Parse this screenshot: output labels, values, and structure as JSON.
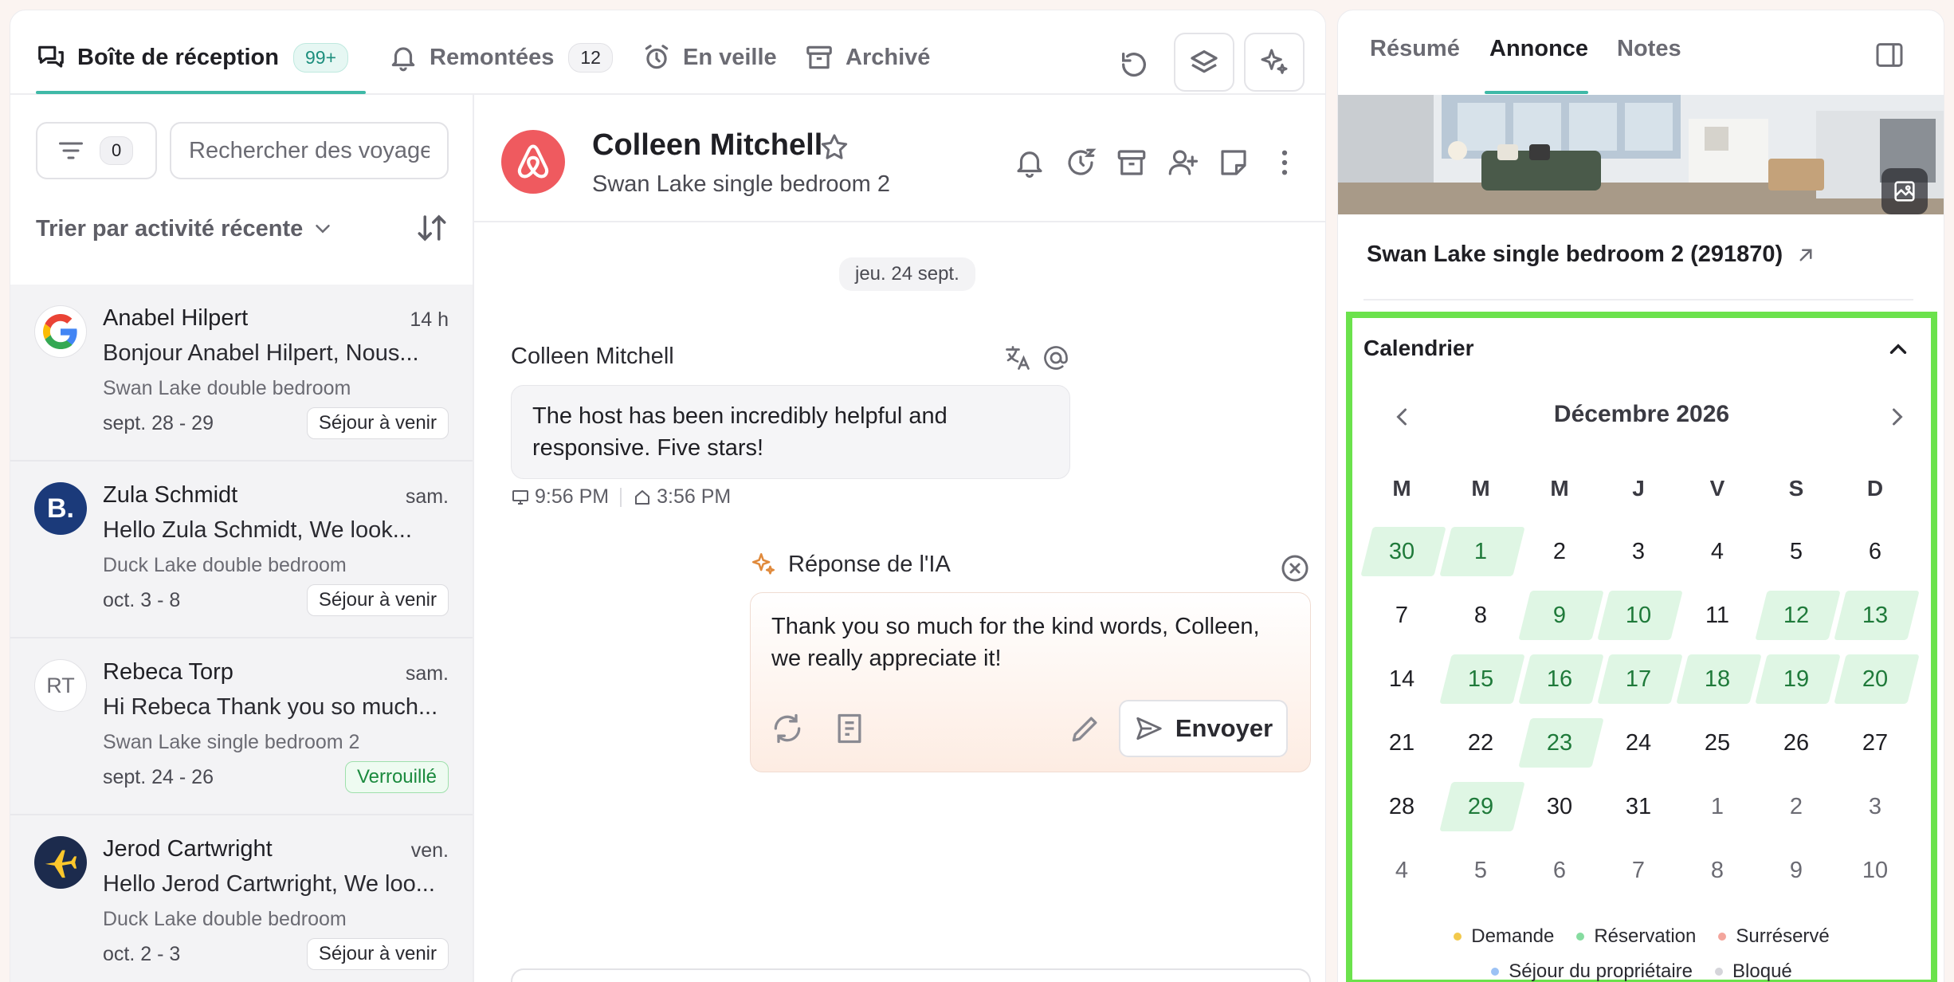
{
  "tabs": {
    "inbox": {
      "label": "Boîte de réception",
      "badge": "99+"
    },
    "escalated": {
      "label": "Remontées",
      "badge": "12"
    },
    "snoozed": {
      "label": "En veille"
    },
    "archived": {
      "label": "Archivé"
    }
  },
  "list": {
    "filter_count": "0",
    "search_placeholder": "Rechercher des voyageurs",
    "sort_label": "Trier par activité récente",
    "conversations": [
      {
        "name": "Anabel Hilpert",
        "time": "14 h",
        "preview": "Bonjour Anabel Hilpert, Nous...",
        "listing": "Swan Lake double bedroom",
        "dates": "sept. 28 - 29",
        "status": "Séjour à venir",
        "avatar": "google-icon"
      },
      {
        "name": "Zula Schmidt",
        "time": "sam.",
        "preview": "Hello Zula Schmidt, We look...",
        "listing": "Duck Lake double bedroom",
        "dates": "oct. 3 - 8",
        "status": "Séjour à venir",
        "avatar": "booking-icon",
        "avatar_text": "B."
      },
      {
        "name": "Rebeca Torp",
        "time": "sam.",
        "preview": "Hi Rebeca Thank you so much...",
        "listing": "Swan Lake single bedroom 2",
        "dates": "sept. 24 - 26",
        "status": "Verrouillé",
        "avatar": "initials",
        "avatar_text": "RT"
      },
      {
        "name": "Jerod Cartwright",
        "time": "ven.",
        "preview": "Hello Jerod Cartwright, We loo...",
        "listing": "Duck Lake double bedroom",
        "dates": "oct. 2 - 3",
        "status": "Séjour à venir",
        "avatar": "expedia-icon"
      }
    ]
  },
  "chat": {
    "guest_name": "Colleen Mitchell",
    "listing": "Swan Lake single bedroom 2",
    "date_chip": "jeu. 24 sept.",
    "message": {
      "sender": "Colleen Mitchell",
      "text": "The host has been incredibly helpful and responsive. Five stars!",
      "time_local": "9:56 PM",
      "time_property": "3:56 PM"
    },
    "ai": {
      "title": "Réponse de l'IA",
      "text": "Thank you so much for the kind words, Colleen, we really appreciate it!",
      "send_label": "Envoyer"
    }
  },
  "panel": {
    "tabs": [
      "Résumé",
      "Annonce",
      "Notes"
    ],
    "active_tab": "Annonce",
    "listing_title": "Swan Lake single bedroom 2 (291870)",
    "calendar": {
      "heading": "Calendrier",
      "month": "Décembre 2026",
      "weekdays": [
        "M",
        "M",
        "M",
        "J",
        "V",
        "S",
        "D"
      ],
      "weeks": [
        [
          [
            "30",
            "other-booked"
          ],
          [
            "1",
            "booked"
          ],
          [
            "2",
            ""
          ],
          [
            "3",
            ""
          ],
          [
            "4",
            ""
          ],
          [
            "5",
            ""
          ],
          [
            "6",
            ""
          ]
        ],
        [
          [
            "7",
            ""
          ],
          [
            "8",
            ""
          ],
          [
            "9",
            "booked"
          ],
          [
            "10",
            "booked"
          ],
          [
            "11",
            ""
          ],
          [
            "12",
            "booked"
          ],
          [
            "13",
            "booked"
          ]
        ],
        [
          [
            "14",
            ""
          ],
          [
            "15",
            "booked"
          ],
          [
            "16",
            "booked"
          ],
          [
            "17",
            "booked"
          ],
          [
            "18",
            "booked"
          ],
          [
            "19",
            "booked"
          ],
          [
            "20",
            "booked"
          ]
        ],
        [
          [
            "21",
            ""
          ],
          [
            "22",
            ""
          ],
          [
            "23",
            "booked"
          ],
          [
            "24",
            ""
          ],
          [
            "25",
            ""
          ],
          [
            "26",
            ""
          ],
          [
            "27",
            ""
          ]
        ],
        [
          [
            "28",
            ""
          ],
          [
            "29",
            "booked"
          ],
          [
            "30",
            ""
          ],
          [
            "31",
            ""
          ],
          [
            "1",
            "other"
          ],
          [
            "2",
            "other"
          ],
          [
            "3",
            "other"
          ]
        ],
        [
          [
            "4",
            "other"
          ],
          [
            "5",
            "other"
          ],
          [
            "6",
            "other"
          ],
          [
            "7",
            "other"
          ],
          [
            "8",
            "other"
          ],
          [
            "9",
            "other"
          ],
          [
            "10",
            "other"
          ]
        ]
      ],
      "legend": [
        {
          "label": "Demande",
          "color": "#f2c94c"
        },
        {
          "label": "Réservation",
          "color": "#86dca0"
        },
        {
          "label": "Surréservé",
          "color": "#f3a59c"
        },
        {
          "label": "Séjour du propriétaire",
          "color": "#9cc2f5"
        },
        {
          "label": "Bloqué",
          "color": "#d5d5da"
        }
      ]
    }
  },
  "colors": {
    "accent": "#3fb9a7",
    "airbnb": "#ef5a5f",
    "booked_bg": "#dff6e4",
    "highlight_border": "#6be24c"
  }
}
